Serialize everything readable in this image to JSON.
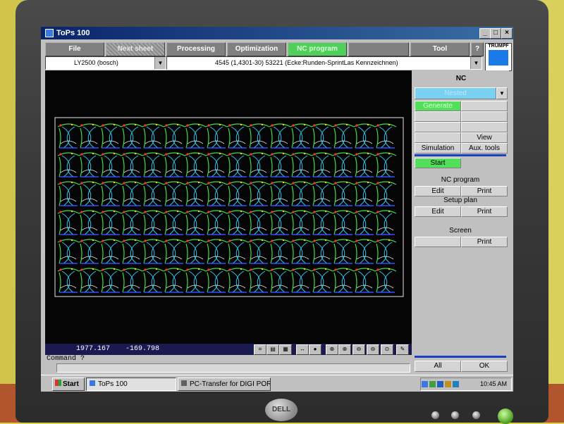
{
  "window": {
    "title": "ToPs 100",
    "min": "_",
    "max": "□",
    "close": "×"
  },
  "menu": [
    "File",
    "Next sheet",
    "Processing",
    "Optimization",
    "NC program",
    "",
    "Tool",
    "?"
  ],
  "logo_text": "TRUMPF",
  "machine_combo": "LY2500 (bosch)",
  "part_combo": "4545 (1,4301-30)    53221 (Ecke:Runden-SprintLas Kennzeichnen)",
  "coords": {
    "x": "1977.167",
    "y": "-169.798"
  },
  "command_label": "Command ?",
  "right_panel": {
    "header": "NC",
    "selector": "Nested",
    "generate": "Generate",
    "view": "View",
    "simulation": "Simulation",
    "aux_tools": "Aux. tools",
    "start": "Start",
    "nc_program": "NC program",
    "setup_plan": "Setup plan",
    "screen": "Screen",
    "edit": "Edit",
    "print": "Print",
    "all": "All",
    "ok": "OK"
  },
  "taskbar": {
    "start": "Start",
    "task1": "ToPs 100",
    "task2": "PC-Transfer for DIGI POR...",
    "time": "10:45 AM"
  },
  "monitor_brand": "DELL",
  "colors": {
    "accent_green": "#52e05a",
    "titlebar": "#0a246a",
    "canvas": "#050505"
  }
}
